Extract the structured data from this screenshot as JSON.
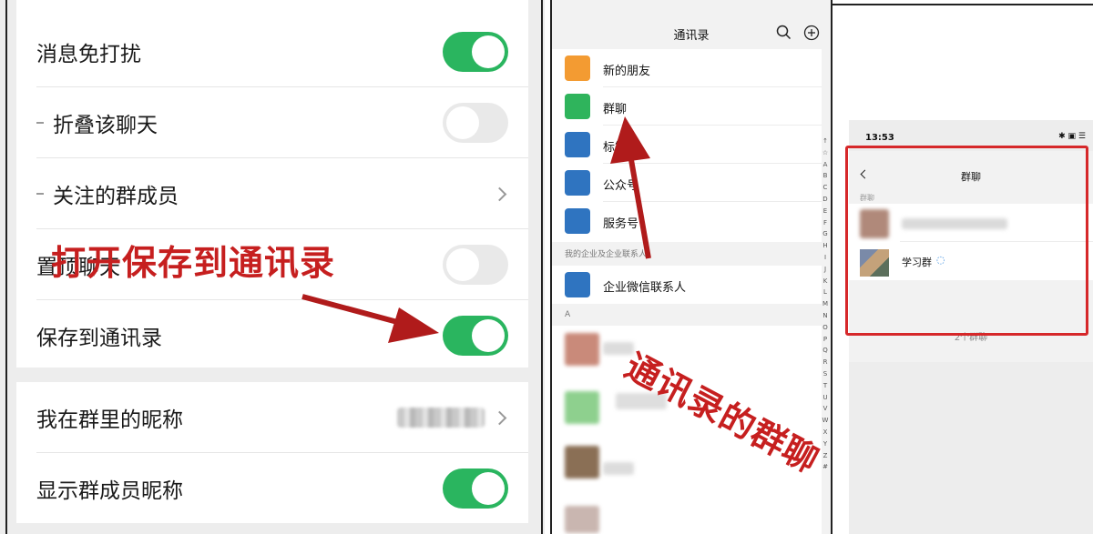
{
  "settings": {
    "mute_label": "消息免打扰",
    "fold_label": "折叠该聊天",
    "follow_label": "关注的群成员",
    "pin_label": "置顶聊天",
    "save_label": "保存到通讯录",
    "nickname_label": "我在群里的昵称",
    "show_nick_label": "显示群成员昵称",
    "toggle_on_color": "#2ab55f"
  },
  "annotations": {
    "open_save": "打开保存到通讯录",
    "contacts_groups": "通讯录的群聊"
  },
  "contacts": {
    "title": "通讯录",
    "items": [
      "新的朋友",
      "群聊",
      "标签",
      "公众号",
      "服务号"
    ],
    "section_label": "我的企业及企业联系人",
    "enterprise_item": "企业微信联系人",
    "letter_a": "A",
    "alphabet": [
      "↑",
      "☆",
      "A",
      "B",
      "C",
      "D",
      "E",
      "F",
      "G",
      "H",
      "I",
      "J",
      "K",
      "L",
      "M",
      "N",
      "O",
      "P",
      "Q",
      "R",
      "S",
      "T",
      "U",
      "V",
      "W",
      "X",
      "Y",
      "Z",
      "#"
    ]
  },
  "groups": {
    "time": "13:53",
    "status_icons": "✱ ▣ ☰",
    "title": "群聊",
    "section_label": "群聊",
    "item_name": "学习群",
    "count_text": "2个群聊"
  }
}
